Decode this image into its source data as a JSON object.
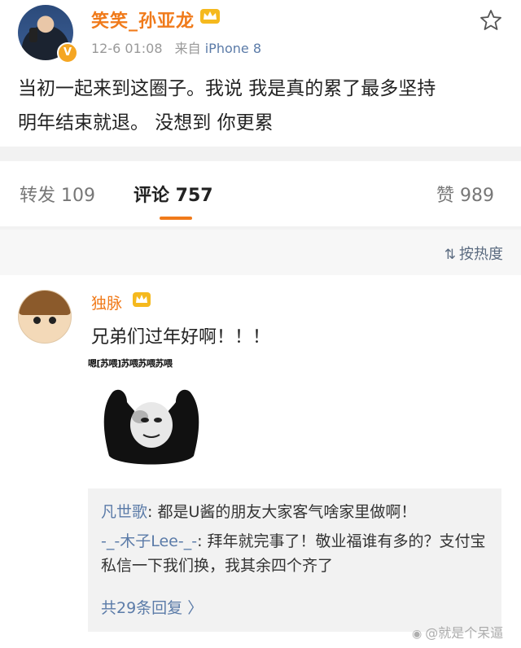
{
  "post": {
    "username": "笑笑_孙亚龙",
    "verified_badge": "V",
    "time": "12-6 01:08",
    "source_prefix": "来自",
    "source": "iPhone 8",
    "content": "当初一起来到这圈子。我说  我是真的累了最多坚持\n明年结束就退。  没想到    你更累",
    "icons": {
      "crown": "crown-icon",
      "star": "star-icon"
    }
  },
  "tabs": [
    {
      "label": "转发 109"
    },
    {
      "label": "评论 757"
    },
    {
      "label": "赞 989"
    }
  ],
  "sort": {
    "label": "按热度",
    "icon": "sort-icon"
  },
  "comment": {
    "username": "独脉",
    "text": "兄弟们过年好啊！！！",
    "meme_caption": "嗯[苏喂]苏喂苏喂苏喂",
    "replies": [
      {
        "user": "凡世歌",
        "text": ": 都是U酱的朋友大家客气啥家里做啊！"
      },
      {
        "user": "-_-木子Lee-_-",
        "text": ": 拜年就完事了！敬业福谁有多的？支付宝私信一下我们换，我其余四个齐了"
      }
    ],
    "more_replies": "共29条回复 〉"
  },
  "watermark": "@就是个呆逼",
  "colors": {
    "accent": "#f07a1a",
    "link": "#5b7ba8"
  }
}
